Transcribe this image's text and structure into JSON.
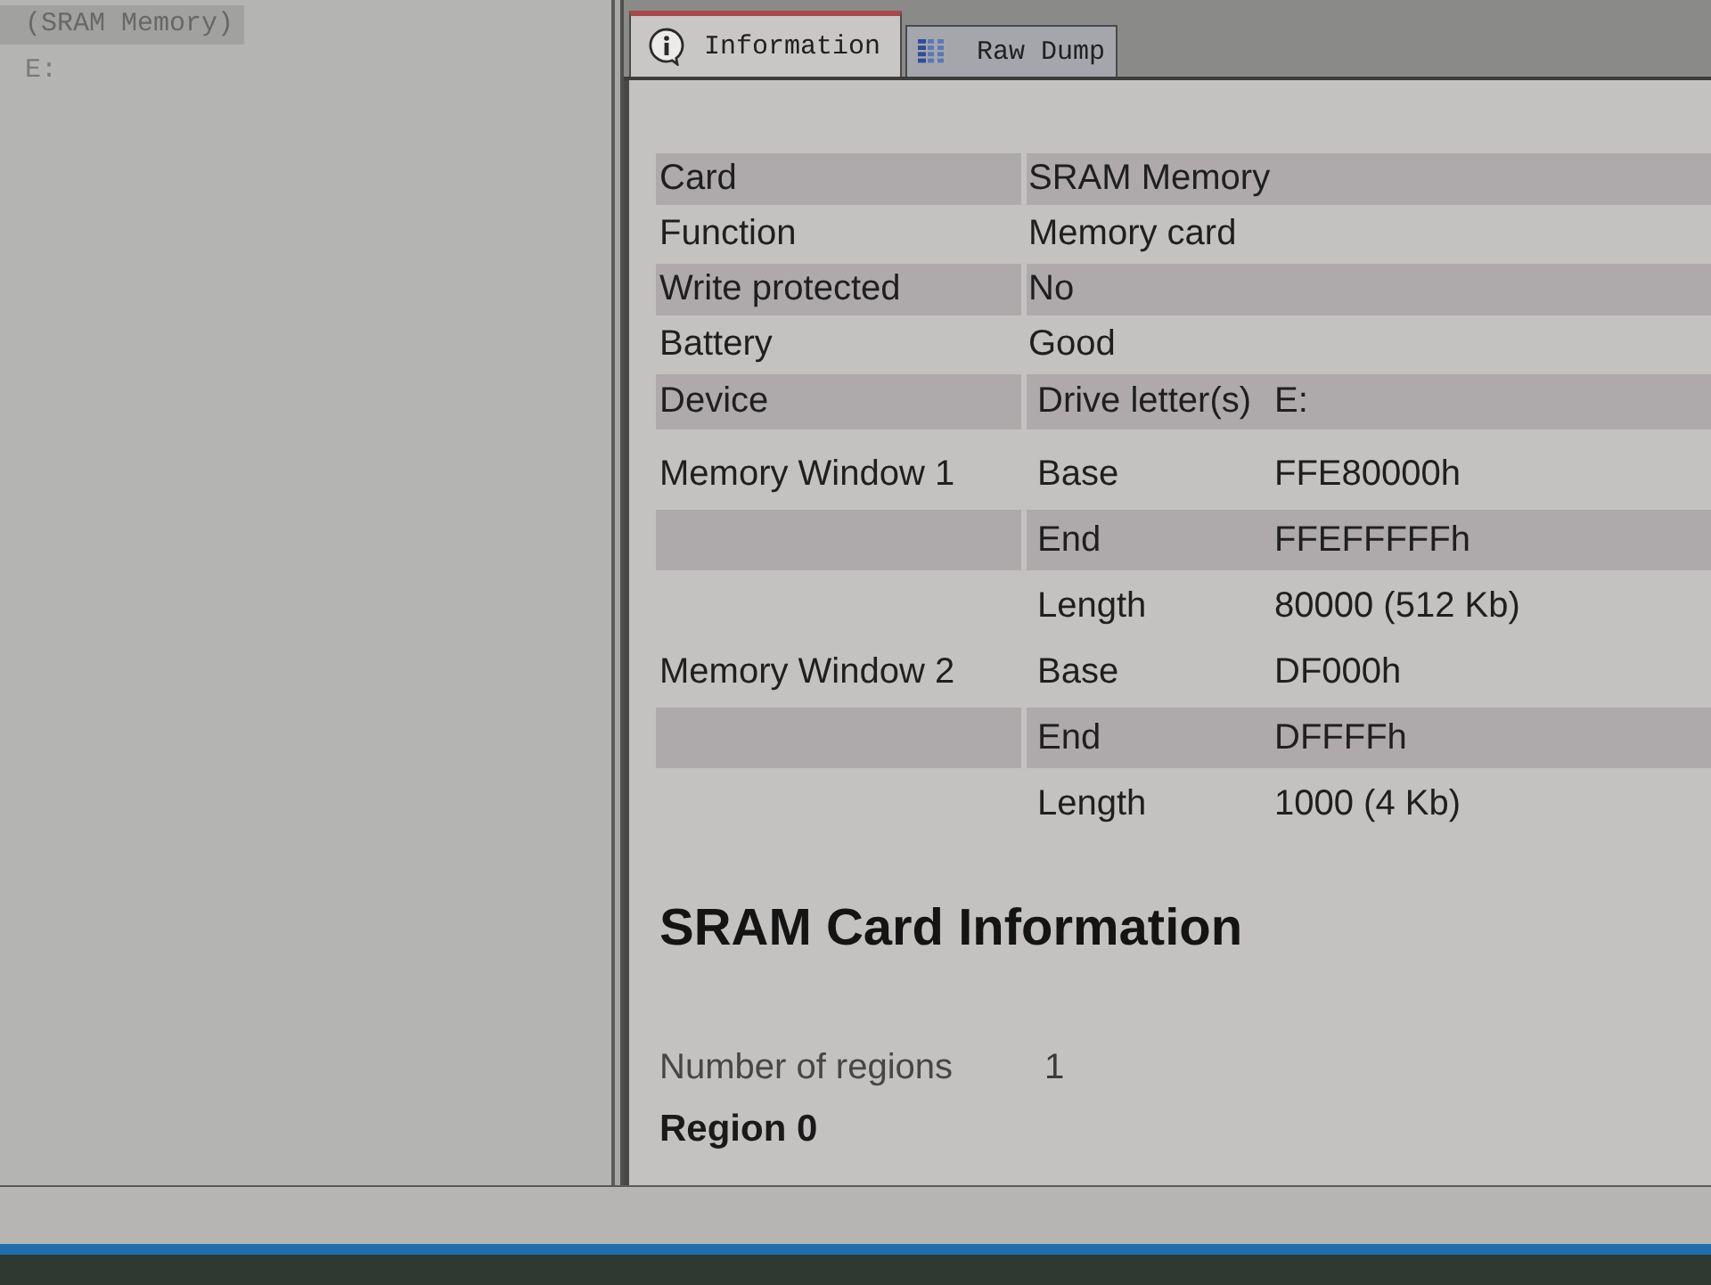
{
  "tree": {
    "items": [
      {
        "label": "(SRAM Memory)",
        "selected": true
      },
      {
        "label": "E:",
        "selected": false
      }
    ]
  },
  "tabs": [
    {
      "label": "Information",
      "selected": true
    },
    {
      "label": "Raw Dump",
      "selected": false
    }
  ],
  "properties": [
    {
      "label": "Card",
      "value": "SRAM Memory",
      "shaded": true
    },
    {
      "label": "Function",
      "value": "Memory card",
      "shaded": false
    },
    {
      "label": "Write protected",
      "value": "No",
      "shaded": true
    },
    {
      "label": "Battery",
      "value": "Good",
      "shaded": false
    },
    {
      "label": "Device",
      "field": "Drive letter(s)",
      "value": "E:",
      "shaded": true
    }
  ],
  "memory_windows": [
    {
      "label": "Memory Window 1",
      "entries": [
        {
          "field": "Base",
          "value": "FFE80000h",
          "shaded": false
        },
        {
          "field": "End",
          "value": "FFEFFFFFh",
          "shaded": true
        },
        {
          "field": "Length",
          "value": "80000 (512 Kb)",
          "shaded": false
        }
      ]
    },
    {
      "label": "Memory Window 2",
      "entries": [
        {
          "field": "Base",
          "value": "DF000h",
          "shaded": false
        },
        {
          "field": "End",
          "value": "DFFFFh",
          "shaded": true
        },
        {
          "field": "Length",
          "value": "1000 (4 Kb)",
          "shaded": false
        }
      ]
    }
  ],
  "sram_section": {
    "title": "SRAM Card Information",
    "fields": [
      {
        "label": "Number of regions",
        "value": "1"
      }
    ],
    "region_title": "Region 0"
  }
}
